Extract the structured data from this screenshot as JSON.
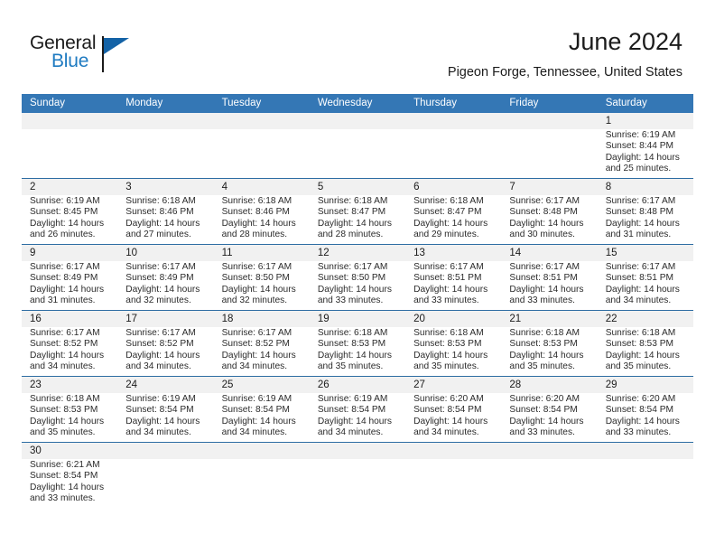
{
  "brand": {
    "name_top": "General",
    "name_bottom": "Blue",
    "color_top": "#1b1b1b",
    "color_bottom": "#1f7bc1",
    "flag_color": "#1362a6"
  },
  "header": {
    "title": "June 2024",
    "subtitle": "Pigeon Forge, Tennessee, United States"
  },
  "colors": {
    "header_row_bg": "#3477b5",
    "header_row_text": "#ffffff",
    "daynum_band_bg": "#f1f1f1",
    "row_separator": "#2d6da3",
    "body_text": "#2b2b2b"
  },
  "weekdays": [
    "Sunday",
    "Monday",
    "Tuesday",
    "Wednesday",
    "Thursday",
    "Friday",
    "Saturday"
  ],
  "weeks": [
    {
      "days": [
        {
          "num": "",
          "lines": []
        },
        {
          "num": "",
          "lines": []
        },
        {
          "num": "",
          "lines": []
        },
        {
          "num": "",
          "lines": []
        },
        {
          "num": "",
          "lines": []
        },
        {
          "num": "",
          "lines": []
        },
        {
          "num": "1",
          "lines": [
            "Sunrise: 6:19 AM",
            "Sunset: 8:44 PM",
            "Daylight: 14 hours",
            "and 25 minutes."
          ]
        }
      ]
    },
    {
      "days": [
        {
          "num": "2",
          "lines": [
            "Sunrise: 6:19 AM",
            "Sunset: 8:45 PM",
            "Daylight: 14 hours",
            "and 26 minutes."
          ]
        },
        {
          "num": "3",
          "lines": [
            "Sunrise: 6:18 AM",
            "Sunset: 8:46 PM",
            "Daylight: 14 hours",
            "and 27 minutes."
          ]
        },
        {
          "num": "4",
          "lines": [
            "Sunrise: 6:18 AM",
            "Sunset: 8:46 PM",
            "Daylight: 14 hours",
            "and 28 minutes."
          ]
        },
        {
          "num": "5",
          "lines": [
            "Sunrise: 6:18 AM",
            "Sunset: 8:47 PM",
            "Daylight: 14 hours",
            "and 28 minutes."
          ]
        },
        {
          "num": "6",
          "lines": [
            "Sunrise: 6:18 AM",
            "Sunset: 8:47 PM",
            "Daylight: 14 hours",
            "and 29 minutes."
          ]
        },
        {
          "num": "7",
          "lines": [
            "Sunrise: 6:17 AM",
            "Sunset: 8:48 PM",
            "Daylight: 14 hours",
            "and 30 minutes."
          ]
        },
        {
          "num": "8",
          "lines": [
            "Sunrise: 6:17 AM",
            "Sunset: 8:48 PM",
            "Daylight: 14 hours",
            "and 31 minutes."
          ]
        }
      ]
    },
    {
      "days": [
        {
          "num": "9",
          "lines": [
            "Sunrise: 6:17 AM",
            "Sunset: 8:49 PM",
            "Daylight: 14 hours",
            "and 31 minutes."
          ]
        },
        {
          "num": "10",
          "lines": [
            "Sunrise: 6:17 AM",
            "Sunset: 8:49 PM",
            "Daylight: 14 hours",
            "and 32 minutes."
          ]
        },
        {
          "num": "11",
          "lines": [
            "Sunrise: 6:17 AM",
            "Sunset: 8:50 PM",
            "Daylight: 14 hours",
            "and 32 minutes."
          ]
        },
        {
          "num": "12",
          "lines": [
            "Sunrise: 6:17 AM",
            "Sunset: 8:50 PM",
            "Daylight: 14 hours",
            "and 33 minutes."
          ]
        },
        {
          "num": "13",
          "lines": [
            "Sunrise: 6:17 AM",
            "Sunset: 8:51 PM",
            "Daylight: 14 hours",
            "and 33 minutes."
          ]
        },
        {
          "num": "14",
          "lines": [
            "Sunrise: 6:17 AM",
            "Sunset: 8:51 PM",
            "Daylight: 14 hours",
            "and 33 minutes."
          ]
        },
        {
          "num": "15",
          "lines": [
            "Sunrise: 6:17 AM",
            "Sunset: 8:51 PM",
            "Daylight: 14 hours",
            "and 34 minutes."
          ]
        }
      ]
    },
    {
      "days": [
        {
          "num": "16",
          "lines": [
            "Sunrise: 6:17 AM",
            "Sunset: 8:52 PM",
            "Daylight: 14 hours",
            "and 34 minutes."
          ]
        },
        {
          "num": "17",
          "lines": [
            "Sunrise: 6:17 AM",
            "Sunset: 8:52 PM",
            "Daylight: 14 hours",
            "and 34 minutes."
          ]
        },
        {
          "num": "18",
          "lines": [
            "Sunrise: 6:17 AM",
            "Sunset: 8:52 PM",
            "Daylight: 14 hours",
            "and 34 minutes."
          ]
        },
        {
          "num": "19",
          "lines": [
            "Sunrise: 6:18 AM",
            "Sunset: 8:53 PM",
            "Daylight: 14 hours",
            "and 35 minutes."
          ]
        },
        {
          "num": "20",
          "lines": [
            "Sunrise: 6:18 AM",
            "Sunset: 8:53 PM",
            "Daylight: 14 hours",
            "and 35 minutes."
          ]
        },
        {
          "num": "21",
          "lines": [
            "Sunrise: 6:18 AM",
            "Sunset: 8:53 PM",
            "Daylight: 14 hours",
            "and 35 minutes."
          ]
        },
        {
          "num": "22",
          "lines": [
            "Sunrise: 6:18 AM",
            "Sunset: 8:53 PM",
            "Daylight: 14 hours",
            "and 35 minutes."
          ]
        }
      ]
    },
    {
      "days": [
        {
          "num": "23",
          "lines": [
            "Sunrise: 6:18 AM",
            "Sunset: 8:53 PM",
            "Daylight: 14 hours",
            "and 35 minutes."
          ]
        },
        {
          "num": "24",
          "lines": [
            "Sunrise: 6:19 AM",
            "Sunset: 8:54 PM",
            "Daylight: 14 hours",
            "and 34 minutes."
          ]
        },
        {
          "num": "25",
          "lines": [
            "Sunrise: 6:19 AM",
            "Sunset: 8:54 PM",
            "Daylight: 14 hours",
            "and 34 minutes."
          ]
        },
        {
          "num": "26",
          "lines": [
            "Sunrise: 6:19 AM",
            "Sunset: 8:54 PM",
            "Daylight: 14 hours",
            "and 34 minutes."
          ]
        },
        {
          "num": "27",
          "lines": [
            "Sunrise: 6:20 AM",
            "Sunset: 8:54 PM",
            "Daylight: 14 hours",
            "and 34 minutes."
          ]
        },
        {
          "num": "28",
          "lines": [
            "Sunrise: 6:20 AM",
            "Sunset: 8:54 PM",
            "Daylight: 14 hours",
            "and 33 minutes."
          ]
        },
        {
          "num": "29",
          "lines": [
            "Sunrise: 6:20 AM",
            "Sunset: 8:54 PM",
            "Daylight: 14 hours",
            "and 33 minutes."
          ]
        }
      ]
    },
    {
      "days": [
        {
          "num": "30",
          "lines": [
            "Sunrise: 6:21 AM",
            "Sunset: 8:54 PM",
            "Daylight: 14 hours",
            "and 33 minutes."
          ]
        },
        {
          "num": "",
          "lines": []
        },
        {
          "num": "",
          "lines": []
        },
        {
          "num": "",
          "lines": []
        },
        {
          "num": "",
          "lines": []
        },
        {
          "num": "",
          "lines": []
        },
        {
          "num": "",
          "lines": []
        }
      ]
    }
  ]
}
